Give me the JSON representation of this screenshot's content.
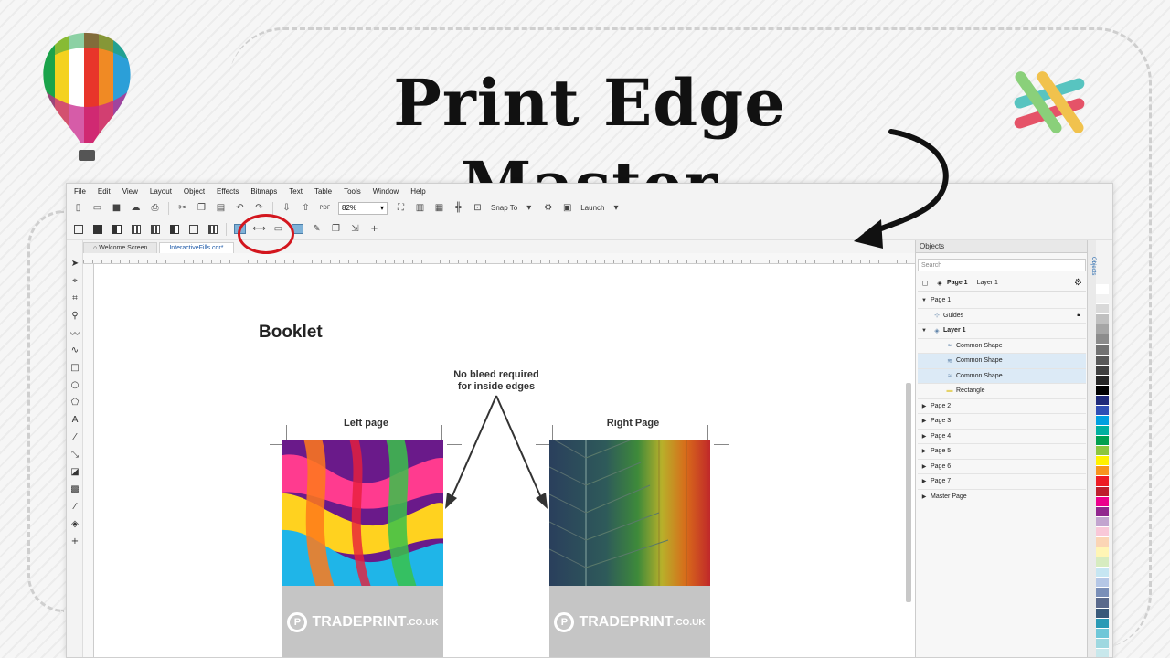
{
  "headline": "Print Edge Master",
  "menu": [
    "File",
    "Edit",
    "View",
    "Layout",
    "Object",
    "Effects",
    "Bitmaps",
    "Text",
    "Table",
    "Tools",
    "Window",
    "Help"
  ],
  "toolbar": {
    "zoom": "82%",
    "snap_label": "Snap To",
    "launch_label": "Launch",
    "pdf_label": "PDF"
  },
  "tabs": [
    "Welcome Screen",
    "InteractiveFills.cdr*"
  ],
  "canvas": {
    "title": "Booklet",
    "note_line1": "No bleed required",
    "note_line2": "for inside edges",
    "left_label": "Left page",
    "right_label": "Right Page",
    "brand_name": "TRADEPRINT",
    "brand_suffix": ".CO.UK"
  },
  "objects_panel": {
    "header": "Objects",
    "search_placeholder": "Search",
    "page_bar_page": "Page 1",
    "page_bar_layer": "Layer 1",
    "rows": [
      {
        "label": "Page 1",
        "expanded": true
      },
      {
        "label": "Guides"
      },
      {
        "label": "Layer 1",
        "expanded": true
      },
      {
        "label": "Common Shape"
      },
      {
        "label": "Common Shape",
        "selected": true
      },
      {
        "label": "Common Shape",
        "selected": true
      },
      {
        "label": "Rectangle"
      },
      {
        "label": "Page 2"
      },
      {
        "label": "Page 3"
      },
      {
        "label": "Page 4"
      },
      {
        "label": "Page 5"
      },
      {
        "label": "Page 6"
      },
      {
        "label": "Page 7"
      },
      {
        "label": "Master Page"
      }
    ],
    "side_tab": "Objects"
  },
  "palette": [
    "#ffffff",
    "#f2f2f2",
    "#d9d9d9",
    "#c0c0c0",
    "#a6a6a6",
    "#8c8c8c",
    "#737373",
    "#595959",
    "#404040",
    "#262626",
    "#000000",
    "#1f2a7a",
    "#2f4fb5",
    "#00a0e0",
    "#00b0a0",
    "#00a050",
    "#8cc63f",
    "#fff200",
    "#f7941d",
    "#ed1c24",
    "#be1e2d",
    "#ec008c",
    "#92278f",
    "#c2a5cf",
    "#f9c8d8",
    "#fbd5b5",
    "#fff5b5",
    "#d7ecc0",
    "#c6e6f2",
    "#b5c7e6",
    "#7a8fb8",
    "#5a6a8c",
    "#3a5a7a",
    "#2a9ab5",
    "#6fc7d8",
    "#9ed8e0",
    "#c8e8ec"
  ],
  "colors": {
    "accent": "#1e5aa8",
    "highlight_circle": "#d3161e",
    "selection": "#dceaf6",
    "brand_box": "#c5c5c5"
  }
}
